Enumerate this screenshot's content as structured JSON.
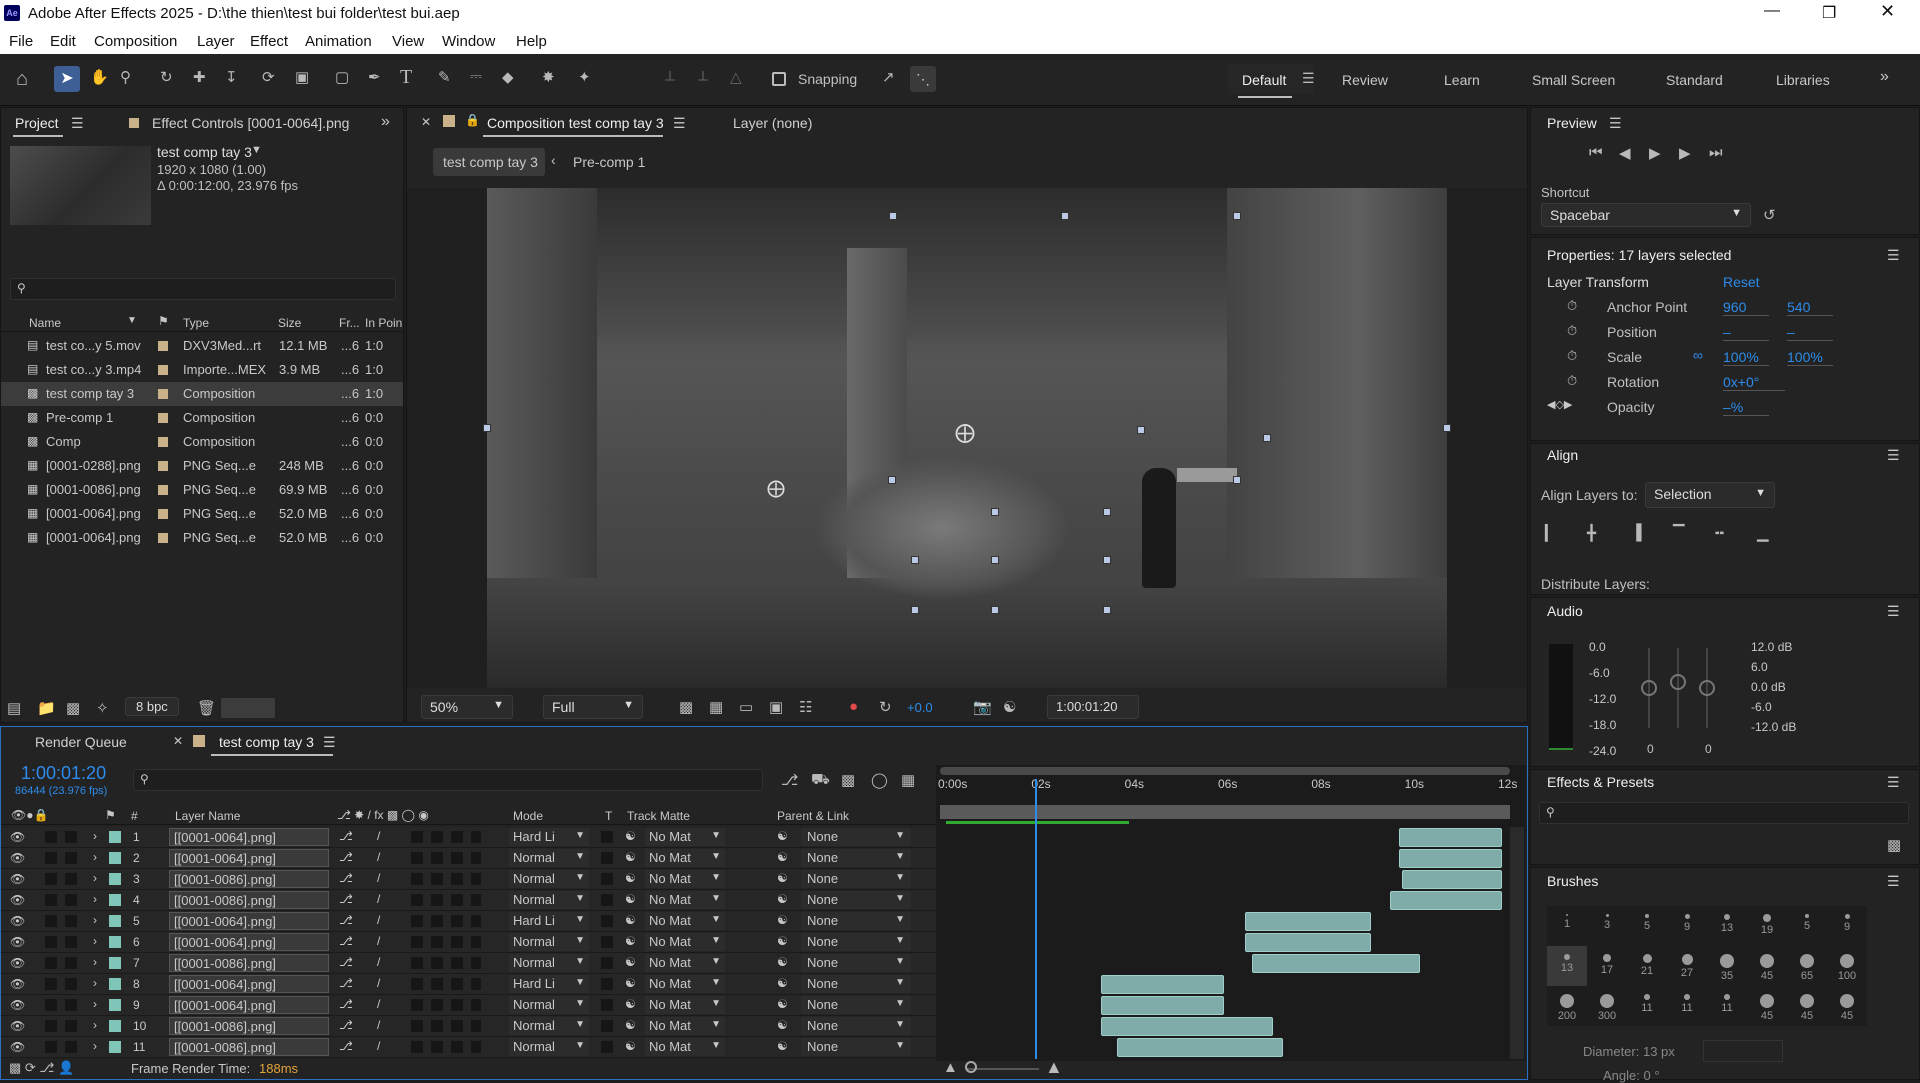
{
  "app": {
    "title": "Adobe After Effects 2025 - D:\\the thien\\test bui folder\\test bui.aep",
    "logo": "Ae"
  },
  "menu": [
    "File",
    "Edit",
    "Composition",
    "Layer",
    "Effect",
    "Animation",
    "View",
    "Window",
    "Help"
  ],
  "toolbar": {
    "snapping": "Snapping"
  },
  "workspaces": [
    "Default",
    "Review",
    "Learn",
    "Small Screen",
    "Standard",
    "Libraries"
  ],
  "project": {
    "tab": "Project",
    "effect_tab": "Effect Controls [0001-0064].png",
    "comp_name": "test comp tay 3",
    "comp_size": "1920 x 1080 (1.00)",
    "comp_duration": "Δ 0:00:12:00, 23.976 fps",
    "columns": [
      "Name",
      "Type",
      "Size",
      "Fr...",
      "In Poin"
    ],
    "items": [
      {
        "name": "test co...y 5.mov",
        "type": "DXV3Med...rt",
        "size": "12.1 MB",
        "fr": "...6",
        "in": "1:0"
      },
      {
        "name": "test co...y 3.mp4",
        "type": "Importe...MEX",
        "size": "3.9 MB",
        "fr": "...6",
        "in": "1:0"
      },
      {
        "name": "test comp tay 3",
        "type": "Composition",
        "size": "",
        "fr": "...6",
        "in": "1:0"
      },
      {
        "name": "Pre-comp 1",
        "type": "Composition",
        "size": "",
        "fr": "...6",
        "in": "0:0"
      },
      {
        "name": "Comp",
        "type": "Composition",
        "size": "",
        "fr": "...6",
        "in": "0:0"
      },
      {
        "name": "[0001-0288].png",
        "type": "PNG Seq...e",
        "size": "248 MB",
        "fr": "...6",
        "in": "0:0"
      },
      {
        "name": "[0001-0086].png",
        "type": "PNG Seq...e",
        "size": "69.9 MB",
        "fr": "...6",
        "in": "0:0"
      },
      {
        "name": "[0001-0064].png",
        "type": "PNG Seq...e",
        "size": "52.0 MB",
        "fr": "...6",
        "in": "0:0"
      },
      {
        "name": "[0001-0064].png",
        "type": "PNG Seq...e",
        "size": "52.0 MB",
        "fr": "...6",
        "in": "0:0"
      }
    ],
    "bpc": "8 bpc"
  },
  "comp": {
    "tab": "Composition test comp tay 3",
    "layer_tab": "Layer (none)",
    "breadcrumb": [
      "test comp tay 3",
      "Pre-comp 1"
    ],
    "zoom": "50%",
    "resolution": "Full",
    "exposure": "+0.0",
    "timecode": "1:00:01:20"
  },
  "preview": {
    "title": "Preview",
    "shortcut_label": "Shortcut",
    "shortcut": "Spacebar"
  },
  "properties": {
    "title": "Properties: 17 layers selected",
    "section": "Layer Transform",
    "reset": "Reset",
    "anchor_label": "Anchor Point",
    "anchor_x": "960",
    "anchor_y": "540",
    "position_label": "Position",
    "position_x": "–",
    "position_y": "–",
    "scale_label": "Scale",
    "scale_x": "100%",
    "scale_y": "100%",
    "rotation_label": "Rotation",
    "rotation": "0x+0°",
    "opacity_label": "Opacity",
    "opacity": "–%"
  },
  "align": {
    "title": "Align",
    "to_label": "Align Layers to:",
    "to": "Selection",
    "distribute": "Distribute Layers:"
  },
  "audio": {
    "title": "Audio",
    "left": [
      "0.0",
      "-6.0",
      "-12.0",
      "-18.0",
      "-24.0"
    ],
    "right": [
      "12.0 dB",
      "6.0",
      "0.0 dB",
      "-6.0",
      "-12.0 dB"
    ],
    "zero_a": "0",
    "zero_b": "0"
  },
  "effects": {
    "title": "Effects & Presets"
  },
  "brushes": {
    "title": "Brushes",
    "row1": [
      "1",
      "3",
      "5",
      "9",
      "13",
      "19",
      "5",
      "9"
    ],
    "row2": [
      "13",
      "17",
      "21",
      "27",
      "35",
      "45",
      "65",
      "100"
    ],
    "row3": [
      "200",
      "300",
      "11",
      "11",
      "11",
      "45",
      "45",
      "45"
    ],
    "diameter": "Diameter: 13 px",
    "angle": "Angle: 0 °"
  },
  "timeline": {
    "render_queue": "Render Queue",
    "comp_tab": "test comp tay 3",
    "time": "1:00:01:20",
    "frames": "86444 (23.976 fps)",
    "headers": {
      "layer": "Layer Name",
      "mode": "Mode",
      "t": "T",
      "matte": "Track Matte",
      "parent": "Parent & Link"
    },
    "ruler": [
      "0:00s",
      "02s",
      "04s",
      "06s",
      "08s",
      "10s",
      "12s"
    ],
    "playhead_seconds": 2.0,
    "duration_seconds": 12,
    "layers": [
      {
        "n": "1",
        "name": "[[0001-0064].png]",
        "mode": "Hard Li",
        "matte": "No Mat",
        "parent": "None",
        "start": 9.8,
        "end": 12
      },
      {
        "n": "2",
        "name": "[[0001-0064].png]",
        "mode": "Normal",
        "matte": "No Mat",
        "parent": "None",
        "start": 9.8,
        "end": 12
      },
      {
        "n": "3",
        "name": "[[0001-0086].png]",
        "mode": "Normal",
        "matte": "No Mat",
        "parent": "None",
        "start": 9.85,
        "end": 12
      },
      {
        "n": "4",
        "name": "[[0001-0086].png]",
        "mode": "Normal",
        "matte": "No Mat",
        "parent": "None",
        "start": 9.6,
        "end": 12
      },
      {
        "n": "5",
        "name": "[[0001-0064].png]",
        "mode": "Hard Li",
        "matte": "No Mat",
        "parent": "None",
        "start": 6.5,
        "end": 9.2
      },
      {
        "n": "6",
        "name": "[[0001-0064].png]",
        "mode": "Normal",
        "matte": "No Mat",
        "parent": "None",
        "start": 6.5,
        "end": 9.2
      },
      {
        "n": "7",
        "name": "[[0001-0086].png]",
        "mode": "Normal",
        "matte": "No Mat",
        "parent": "None",
        "start": 6.65,
        "end": 10.25
      },
      {
        "n": "8",
        "name": "[[0001-0064].png]",
        "mode": "Hard Li",
        "matte": "No Mat",
        "parent": "None",
        "start": 3.4,
        "end": 6.05
      },
      {
        "n": "9",
        "name": "[[0001-0064].png]",
        "mode": "Normal",
        "matte": "No Mat",
        "parent": "None",
        "start": 3.4,
        "end": 6.05
      },
      {
        "n": "10",
        "name": "[[0001-0086].png]",
        "mode": "Normal",
        "matte": "No Mat",
        "parent": "None",
        "start": 3.4,
        "end": 7.1
      },
      {
        "n": "11",
        "name": "[[0001-0086].png]",
        "mode": "Normal",
        "matte": "No Mat",
        "parent": "None",
        "start": 3.75,
        "end": 7.3
      }
    ],
    "render_time_label": "Frame Render Time:",
    "render_time": "188ms"
  }
}
